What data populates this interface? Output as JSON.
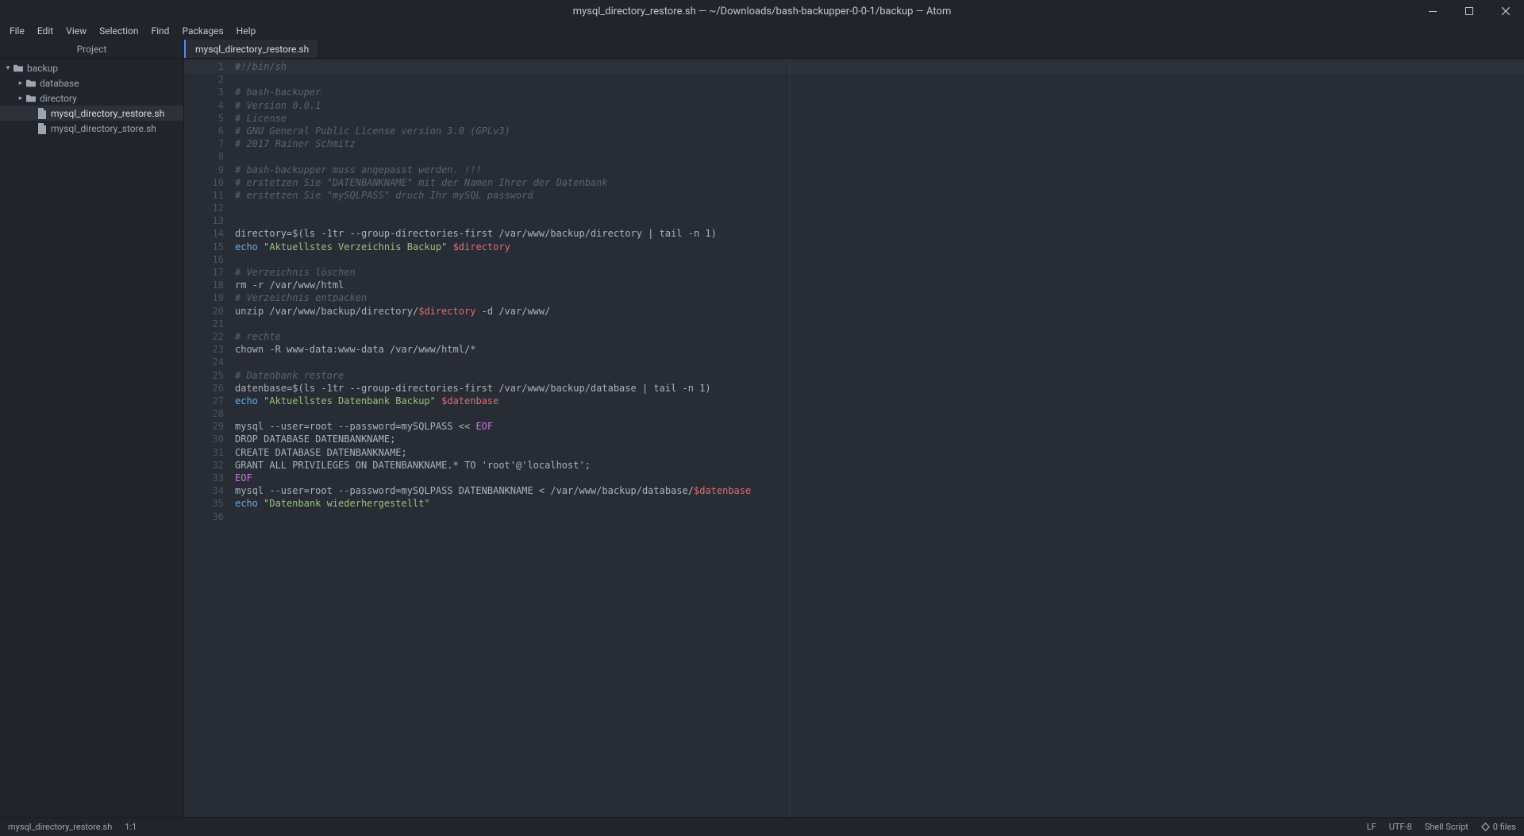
{
  "window": {
    "title": "mysql_directory_restore.sh — ~/Downloads/bash-backupper-0-0-1/backup — Atom"
  },
  "menubar": [
    "File",
    "Edit",
    "View",
    "Selection",
    "Find",
    "Packages",
    "Help"
  ],
  "sidebar": {
    "header": "Project",
    "tree": [
      {
        "label": "backup",
        "icon": "folder-open",
        "indent": 0,
        "chevron": "down",
        "selected": false
      },
      {
        "label": "database",
        "icon": "folder",
        "indent": 1,
        "chevron": "right",
        "selected": false
      },
      {
        "label": "directory",
        "icon": "folder",
        "indent": 1,
        "chevron": "right",
        "selected": false
      },
      {
        "label": "mysql_directory_restore.sh",
        "icon": "file",
        "indent": 2,
        "chevron": "",
        "selected": true
      },
      {
        "label": "mysql_directory_store.sh",
        "icon": "file",
        "indent": 2,
        "chevron": "",
        "selected": false
      }
    ]
  },
  "tabs": [
    {
      "label": "mysql_directory_restore.sh",
      "active": true
    }
  ],
  "code": [
    [
      {
        "t": "#!/bin/sh",
        "c": "c"
      }
    ],
    [],
    [
      {
        "t": "# bash-backuper",
        "c": "c"
      }
    ],
    [
      {
        "t": "# Version 0.0.1",
        "c": "c"
      }
    ],
    [
      {
        "t": "# License",
        "c": "c"
      }
    ],
    [
      {
        "t": "# GNU General Public License version 3.0 (GPLv3)",
        "c": "c"
      }
    ],
    [
      {
        "t": "# 2017 Rainer Schmitz",
        "c": "c"
      }
    ],
    [],
    [
      {
        "t": "# bash-backupper muss angepasst werden. !!!",
        "c": "c"
      }
    ],
    [
      {
        "t": "# erstetzen Sie \"DATENBANKNAME\" mit der Namen Ihrer der Datenbank",
        "c": "c"
      }
    ],
    [
      {
        "t": "# erstetzen Sie \"mySQLPASS\" druch Ihr mySQL password",
        "c": "c"
      }
    ],
    [],
    [],
    [
      {
        "t": "directory=$(ls -1tr --group-directories-first /var/www/backup/directory | tail -n 1)",
        "c": "p"
      }
    ],
    [
      {
        "t": "echo",
        "c": "k"
      },
      {
        "t": " ",
        "c": "p"
      },
      {
        "t": "\"Aktuellstes Verzeichnis Backup\"",
        "c": "s"
      },
      {
        "t": " ",
        "c": "p"
      },
      {
        "t": "$directory",
        "c": "v"
      }
    ],
    [],
    [
      {
        "t": "# Verzeichnis löschen",
        "c": "c"
      }
    ],
    [
      {
        "t": "rm -r /var/www/html",
        "c": "p"
      }
    ],
    [
      {
        "t": "# Verzeichnis entpacken",
        "c": "c"
      }
    ],
    [
      {
        "t": "unzip /var/www/backup/directory/",
        "c": "p"
      },
      {
        "t": "$directory",
        "c": "v"
      },
      {
        "t": " -d /var/www/",
        "c": "p"
      }
    ],
    [],
    [
      {
        "t": "# rechte",
        "c": "c"
      }
    ],
    [
      {
        "t": "chown -R www-data:www-data /var/www/html/*",
        "c": "p"
      }
    ],
    [],
    [
      {
        "t": "# Datenbank restore",
        "c": "c"
      }
    ],
    [
      {
        "t": "datenbase=$(ls -1tr --group-directories-first /var/www/backup/database | tail -n 1)",
        "c": "p"
      }
    ],
    [
      {
        "t": "echo",
        "c": "k"
      },
      {
        "t": " ",
        "c": "p"
      },
      {
        "t": "\"Aktuellstes Datenbank Backup\"",
        "c": "s"
      },
      {
        "t": " ",
        "c": "p"
      },
      {
        "t": "$datenbase",
        "c": "v"
      }
    ],
    [],
    [
      {
        "t": "mysql --user=root --password=mySQLPASS << ",
        "c": "p"
      },
      {
        "t": "EOF",
        "c": "f"
      }
    ],
    [
      {
        "t": "DROP DATABASE DATENBANKNAME;",
        "c": "p"
      }
    ],
    [
      {
        "t": "CREATE DATABASE DATENBANKNAME;",
        "c": "p"
      }
    ],
    [
      {
        "t": "GRANT ALL PRIVILEGES ON DATENBANKNAME.* TO 'root'@'localhost';",
        "c": "p"
      }
    ],
    [
      {
        "t": "EOF",
        "c": "f"
      }
    ],
    [
      {
        "t": "mysql --user=root --password=mySQLPASS DATENBANKNAME < /var/www/backup/database/",
        "c": "p"
      },
      {
        "t": "$datenbase",
        "c": "v"
      }
    ],
    [
      {
        "t": "echo",
        "c": "k"
      },
      {
        "t": " ",
        "c": "p"
      },
      {
        "t": "\"Datenbank wiederhergestellt\"",
        "c": "s"
      }
    ],
    []
  ],
  "statusbar": {
    "file": "mysql_directory_restore.sh",
    "cursor": "1:1",
    "line_ending": "LF",
    "encoding": "UTF-8",
    "language": "Shell Script",
    "git_files": "0 files"
  }
}
